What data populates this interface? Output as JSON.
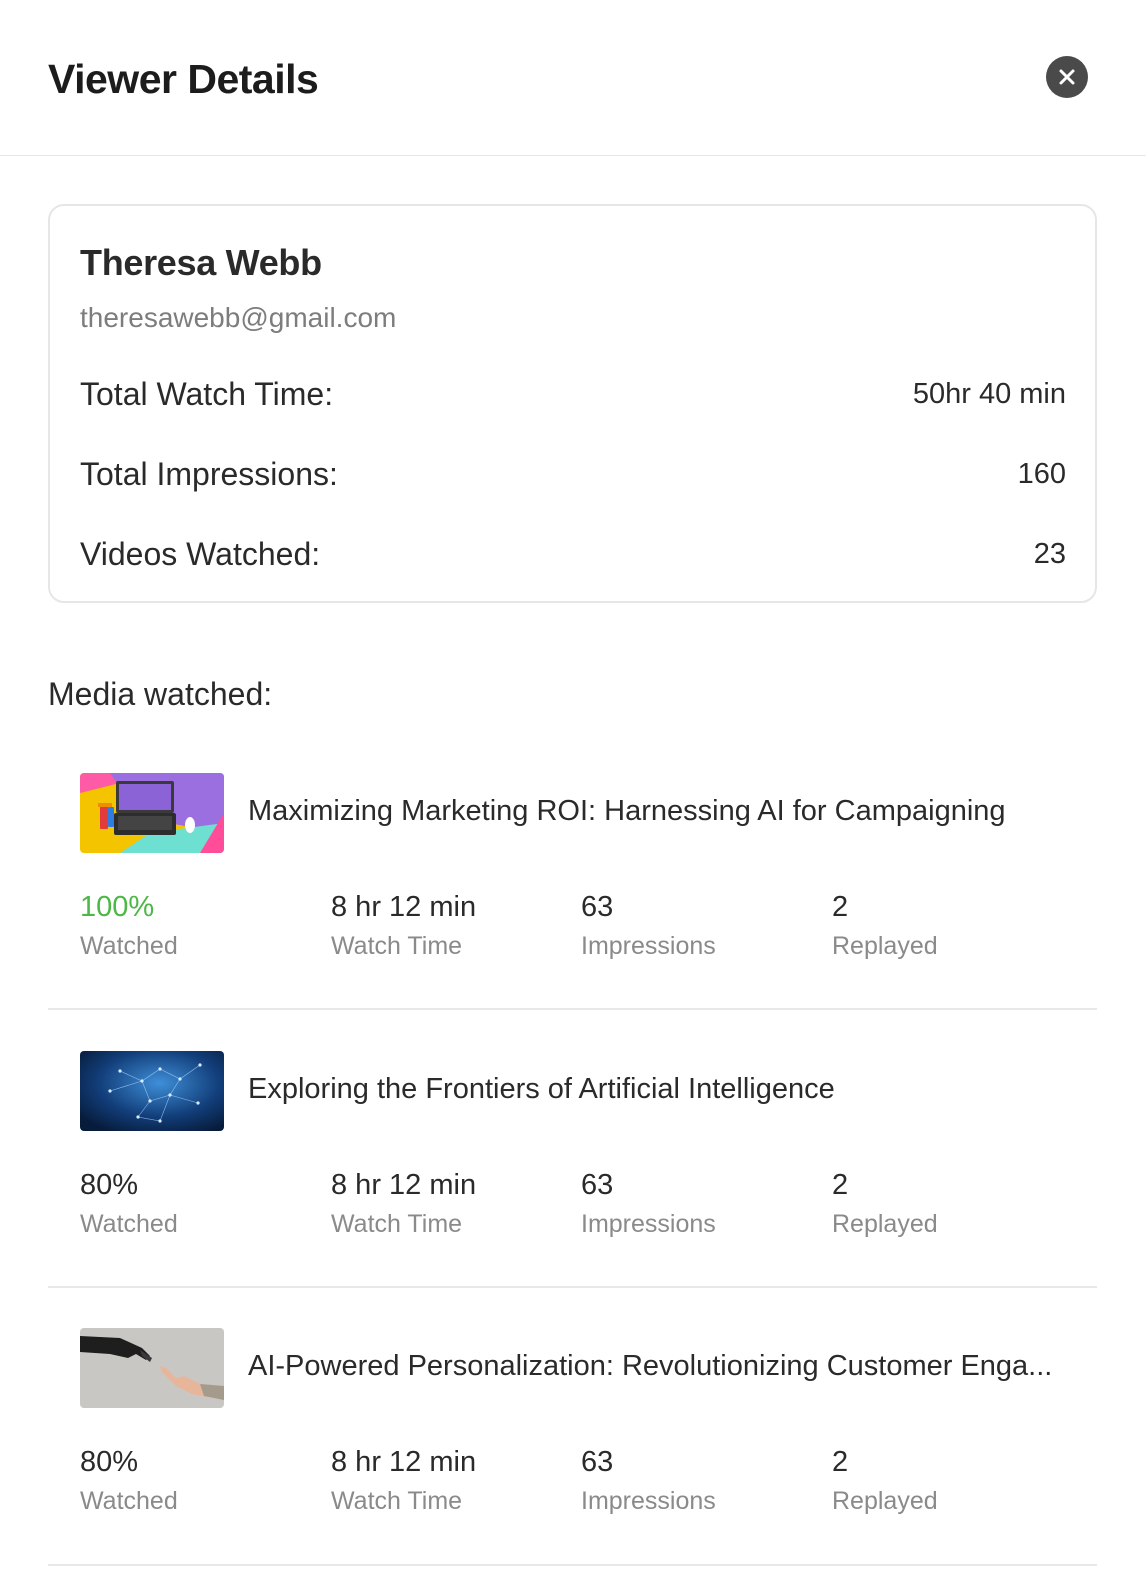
{
  "header": {
    "title": "Viewer Details"
  },
  "viewer": {
    "name": "Theresa Webb",
    "email": "theresawebb@gmail.com",
    "stats": [
      {
        "label": "Total Watch Time:",
        "value": "50hr 40 min"
      },
      {
        "label": "Total Impressions:",
        "value": "160"
      },
      {
        "label": "Videos Watched:",
        "value": "23"
      }
    ]
  },
  "media": {
    "heading": "Media watched:",
    "items": [
      {
        "title": "Maximizing Marketing ROI: Harnessing AI for Campaigning",
        "watched_value": "100%",
        "watched_label": "Watched",
        "watch_time_value": "8 hr 12 min",
        "watch_time_label": "Watch Time",
        "impressions_value": "63",
        "impressions_label": "Impressions",
        "replayed_value": "2",
        "replayed_label": "Replayed"
      },
      {
        "title": "Exploring the Frontiers of Artificial Intelligence",
        "watched_value": "80%",
        "watched_label": "Watched",
        "watch_time_value": "8 hr 12 min",
        "watch_time_label": "Watch Time",
        "impressions_value": "63",
        "impressions_label": "Impressions",
        "replayed_value": "2",
        "replayed_label": "Replayed"
      },
      {
        "title": "AI-Powered Personalization: Revolutionizing Customer Enga...",
        "watched_value": "80%",
        "watched_label": "Watched",
        "watch_time_value": "8 hr 12 min",
        "watch_time_label": "Watch Time",
        "impressions_value": "63",
        "impressions_label": "Impressions",
        "replayed_value": "2",
        "replayed_label": "Replayed"
      }
    ]
  },
  "colors": {
    "complete_green": "#4cb847",
    "close_button": "#4a4a4a"
  }
}
